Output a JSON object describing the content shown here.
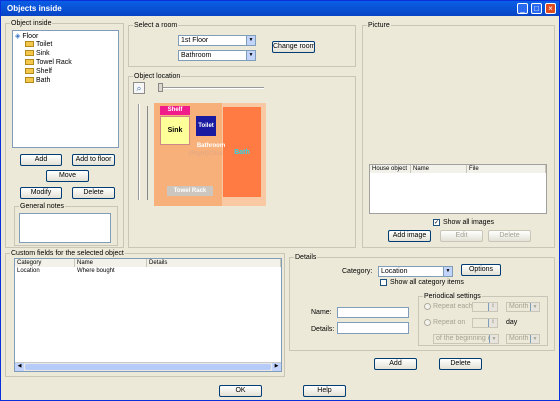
{
  "window": {
    "title": "Objects inside"
  },
  "object_inside": {
    "label": "Object inside",
    "tree": [
      "Floor",
      "Toilet",
      "Sink",
      "Towel Rack",
      "Shelf",
      "Bath"
    ],
    "add": "Add",
    "add_floor": "Add to floor",
    "move": "Move",
    "modify": "Modify",
    "delete": "Delete"
  },
  "general_notes": {
    "label": "General notes"
  },
  "select_room": {
    "label": "Select a room",
    "floor": "1st Floor",
    "room": "Bathroom",
    "change": "Change room"
  },
  "object_location": {
    "label": "Object location",
    "room_label": "Bathroom",
    "hint": "[Right]Click",
    "items": {
      "shelf": "Shelf",
      "sink": "Sink",
      "toilet": "Toilet",
      "bath": "Bath",
      "towel": "Towel Rack"
    }
  },
  "picture": {
    "label": "Picture",
    "columns": [
      "House object",
      "Name",
      "File"
    ],
    "show_all": "Show all images",
    "add_image": "Add image",
    "edit": "Edit",
    "delete": "Delete"
  },
  "custom_fields": {
    "label": "Custom fields for the selected object",
    "columns": [
      "Category",
      "Name",
      "Details"
    ],
    "rows": [
      {
        "category": "Location",
        "name": "Where bought",
        "details": ""
      }
    ]
  },
  "details": {
    "label": "Details",
    "category_label": "Category:",
    "category": "Location",
    "options": "Options",
    "show_all": "Show all category items",
    "name_label": "Name:",
    "details_label": "Details:",
    "periodical": {
      "label": "Periodical settings",
      "repeat_each": "Repeat each",
      "repeat_on": "Repeat on",
      "month": "Month",
      "day": "day",
      "beginning": "of the beginning of"
    },
    "add": "Add",
    "delete": "Delete"
  },
  "footer": {
    "ok": "OK",
    "help": "Help"
  }
}
